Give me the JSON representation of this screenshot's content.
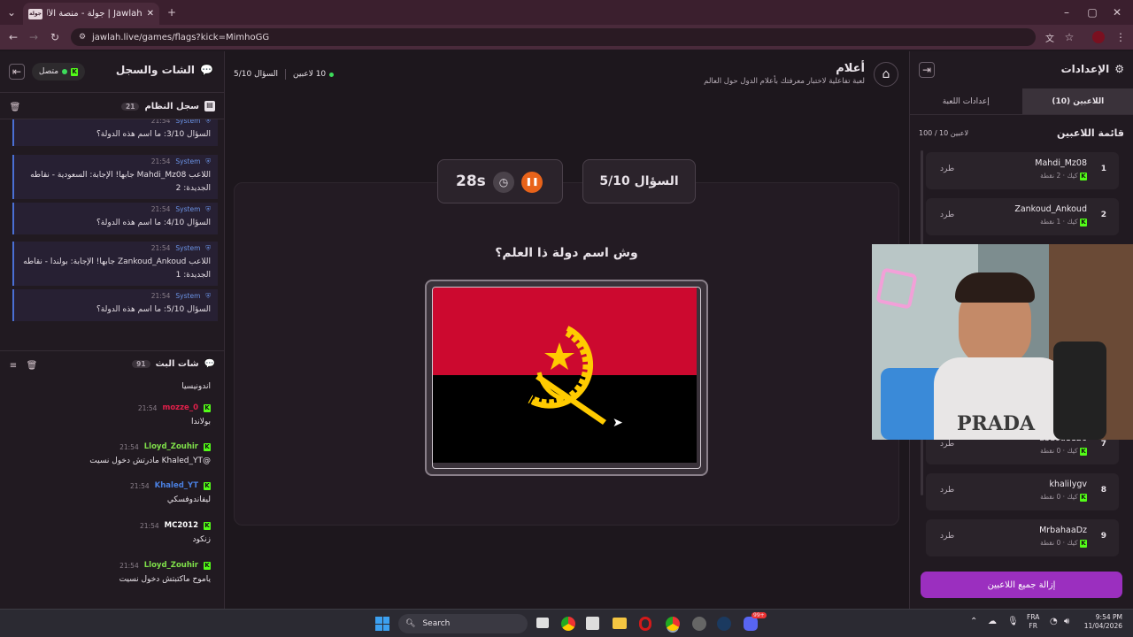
{
  "browser": {
    "tab_title": "Jawlah | جولة - منصة الألعاب الت...",
    "favicon": "جولة",
    "url": "jawlah.live/games/flags?kick=MimhoGG"
  },
  "left": {
    "title": "الشات والسجل",
    "status": "متصل",
    "system_log": {
      "title": "سجل النظام",
      "count": "21",
      "messages": [
        {
          "time": "21:54",
          "sender": "System",
          "text": "السؤال 3/10: ما اسم هذه الدولة؟"
        },
        {
          "time": "21:54",
          "sender": "System",
          "text": "اللاعب Mahdi_Mz08 جابها! الإجابة: السعودية - نقاطه الجديدة: 2"
        },
        {
          "time": "21:54",
          "sender": "System",
          "text": "السؤال 4/10: ما اسم هذه الدولة؟"
        },
        {
          "time": "21:54",
          "sender": "System",
          "text": "اللاعب Zankoud_Ankoud جابها! الإجابة: بولندا - نقاطه الجديدة: 1"
        },
        {
          "time": "21:54",
          "sender": "System",
          "text": "السؤال 5/10: ما اسم هذه الدولة؟"
        }
      ]
    },
    "stream_chat": {
      "title": "شات البث",
      "count": "91",
      "first_text": "اندونيسيا",
      "messages": [
        {
          "time": "21:54",
          "user": "mozze_0",
          "color": "#e0204a",
          "text": "بولاندا"
        },
        {
          "time": "21:54",
          "user": "Lloyd_Zouhir",
          "color": "#7fe04a",
          "text": "@Khaled_YT مادرتش دخول نسيت"
        },
        {
          "time": "21:54",
          "user": "Khaled_YT",
          "color": "#4a7fe0",
          "text": "ليفاندوفسكي"
        },
        {
          "time": "21:54",
          "user": "MC2012",
          "color": "#ffffff",
          "text": "زنكود"
        },
        {
          "time": "21:54",
          "user": "Lloyd_Zouhir",
          "color": "#7fe04a",
          "text": "ياموح ماكتبتش دخول نسيت"
        }
      ]
    }
  },
  "header": {
    "title": "أعلام",
    "subtitle": "لعبة تفاعلية لاختبار معرفتك بأعلام الدول حول العالم",
    "players": "10 لاعبين",
    "question": "السؤال 5/10"
  },
  "game": {
    "timer": "28s",
    "question_badge": "السؤال 5/10",
    "prompt": "وش اسم دولة ذا العلم؟"
  },
  "right": {
    "title": "الإعدادات",
    "tab_players": "اللاعبين (10)",
    "tab_settings": "إعدادات اللعبة",
    "list_title": "قائمة اللاعبين",
    "capacity": "100 / 10 لاعبين",
    "kick_label": "طرد",
    "remove_all": "إزالة جميع اللاعبين",
    "players": [
      {
        "rank": "1",
        "name": "Mahdi_Mz08",
        "points": "2 نقطة",
        "platform": "كيك"
      },
      {
        "rank": "2",
        "name": "Zankoud_Ankoud",
        "points": "1 نقطة",
        "platform": "كيك"
      },
      {
        "rank": "7",
        "name": "abdou1126",
        "points": "0 نقطة",
        "platform": "كيك"
      },
      {
        "rank": "8",
        "name": "khalilygv",
        "points": "0 نقطة",
        "platform": "كيك"
      },
      {
        "rank": "9",
        "name": "MrbahaaDz",
        "points": "0 نقطة",
        "platform": "كيك"
      }
    ]
  },
  "taskbar": {
    "search": "Search",
    "lang1": "FRA",
    "lang2": "FR",
    "time": "9:54 PM",
    "date": "11/04/2026",
    "badge": "99+"
  },
  "webcam": {
    "shirt_text": "PRADA"
  },
  "colors": {
    "accent": "#9b2fbf",
    "flag_red": "#cc092f",
    "flag_black": "#000000",
    "flag_yellow": "#ffcb00",
    "kick_green": "#53fc18"
  }
}
